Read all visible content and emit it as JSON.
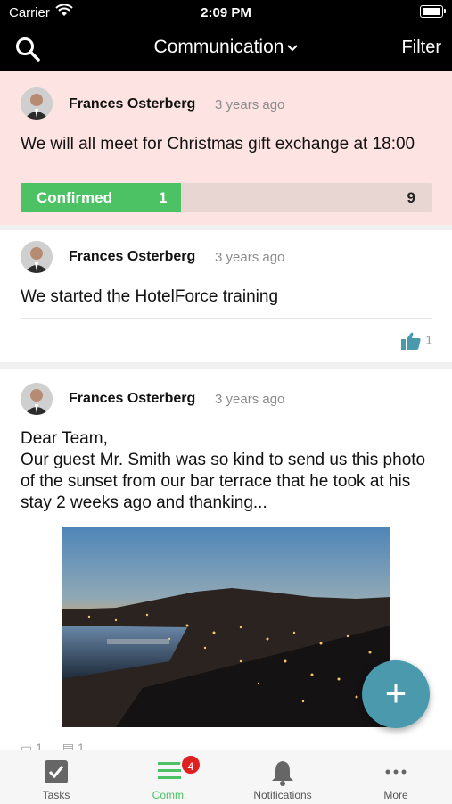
{
  "status": {
    "carrier": "Carrier",
    "time": "2:09 PM"
  },
  "header": {
    "title": "Communication",
    "filter_label": "Filter"
  },
  "posts": [
    {
      "author": "Frances Osterberg",
      "time_ago": "3 years ago",
      "text": "We will all meet for Christmas gift exchange at 18:00",
      "poll": {
        "label": "Confirmed",
        "confirmed": 1,
        "total": 9,
        "confirmed_fraction": 0.39
      }
    },
    {
      "author": "Frances Osterberg",
      "time_ago": "3 years ago",
      "text": "We started the HotelForce training",
      "likes": "1"
    },
    {
      "author": "Frances Osterberg",
      "time_ago": "3 years ago",
      "text_lines": [
        "Dear Team,",
        "Our guest Mr. Smith was so kind to send us this photo of the sunset from our bar terrace that he took at his stay 2 weeks ago and thanking..."
      ],
      "comments": "1",
      "reads": "1"
    }
  ],
  "fab": {
    "label": "+"
  },
  "tabs": [
    {
      "label": "Tasks",
      "icon": "checkbox-icon"
    },
    {
      "label": "Comm.",
      "icon": "list-icon",
      "badge": "4",
      "active": true
    },
    {
      "label": "Notifications",
      "icon": "bell-icon"
    },
    {
      "label": "More",
      "icon": "more-dots-icon"
    }
  ],
  "colors": {
    "accent_green": "#4cc265",
    "fab": "#4a99ac",
    "highlight_bg": "#fde3e1",
    "badge": "#e02020",
    "like_blue": "#4a99ac"
  }
}
